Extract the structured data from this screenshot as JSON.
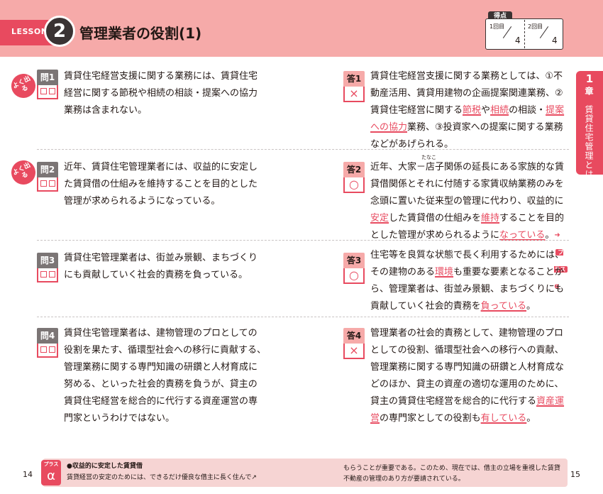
{
  "header": {
    "lesson_label": "LESSON",
    "lesson_number": "2",
    "title": "管理業者の役割(1)",
    "score": {
      "tab": "得点",
      "round1_label": "1回目",
      "round2_label": "2回目",
      "round1_total": "4",
      "round2_total": "4"
    }
  },
  "chapter": {
    "number": "1",
    "label": "章",
    "title": "賃貸住宅管理とは"
  },
  "badges": {
    "frequent": "よく出る",
    "plus": "プラス",
    "alpha": "α",
    "correct_mark": "○",
    "wrong_mark": "×"
  },
  "items": [
    {
      "q_label": "問1",
      "a_label": "答1",
      "frequent": true,
      "question": [
        "賃貸住宅経営支援に関する業務には、賃貸住宅",
        "経営に関する節税や相続の相談・提案への協力",
        "業務は含まれない。"
      ],
      "answer_mark": "×",
      "answer_parts": [
        {
          "t": "賃貸住宅経営支援に関する業務としては、①不動",
          "k": false
        },
        {
          "t": "産活用、賃貸用建物の企画提案関連業務、②賃貸",
          "k": false
        },
        {
          "t": "住宅経営に関する",
          "k": false
        },
        {
          "t": "節税",
          "k": true
        },
        {
          "t": "や",
          "k": false
        },
        {
          "t": "相続",
          "k": true
        },
        {
          "t": "の相談・",
          "k": false
        },
        {
          "t": "提案への協力",
          "k": true
        },
        {
          "t": "業務、③投資家への提案に関する業務などがあげられる。",
          "k": false
        }
      ]
    },
    {
      "q_label": "問2",
      "a_label": "答2",
      "frequent": true,
      "question": [
        "近年、賃貸住宅管理業者には、収益的に安定し",
        "た賃貸借の仕組みを維持することを目的とした",
        "管理が求められるようになっている。"
      ],
      "answer_mark": "○",
      "answer_parts": [
        {
          "t": "近年、大家－店子関係の延長にある家族的な賃貸借関係とそれに付随する家賃収納業務のみを念頭に置いた従来型の管理に代わり、収益的に",
          "k": false
        },
        {
          "t": "安定",
          "k": true
        },
        {
          "t": "した賃貸借の仕組みを",
          "k": false
        },
        {
          "t": "維持",
          "k": true
        },
        {
          "t": "することを目的とした管理が求められるように",
          "k": false
        },
        {
          "t": "なっている",
          "k": true
        },
        {
          "t": "。",
          "k": false
        }
      ],
      "ruby": "たなこ"
    },
    {
      "q_label": "問3",
      "a_label": "答3",
      "frequent": false,
      "question": [
        "賃貸住宅管理業者は、街並み景観、まちづくり",
        "にも貢献していく社会的責務を負っている。"
      ],
      "answer_mark": "○",
      "answer_parts": [
        {
          "t": "住宅等を良質な状態で長く利用するためには、その建物のある",
          "k": false
        },
        {
          "t": "環境",
          "k": true
        },
        {
          "t": "も重要な要素となることから、管理業者は、街並み景観、まちづくりにも貢献していく社会的責務を",
          "k": false
        },
        {
          "t": "負っている",
          "k": true
        },
        {
          "t": "。",
          "k": false
        }
      ]
    },
    {
      "q_label": "問4",
      "a_label": "答4",
      "frequent": false,
      "question": [
        "賃貸住宅管理業者は、建物管理のプロとしての",
        "役割を果たす、循環型社会への移行に貢献する、",
        "管理業務に関する専門知識の研鑽と人材育成に",
        "努める、といった社会的責務を負うが、貸主の",
        "賃貸住宅経営を総合的に代行する資産運営の専",
        "門家というわけではない。"
      ],
      "answer_mark": "×",
      "answer_parts": [
        {
          "t": "管理業者の社会的責務として、建物管理のプロとしての役割、循環型社会への移行への貢献、管理業務に関する専門知識の研鑽と人材育成などのほか、貸主の資産の適切な運用のために、貸主の賃貸住宅経営を総合的に代行する",
          "k": false
        },
        {
          "t": "資産運営",
          "k": true
        },
        {
          "t": "の専門家としての役割も",
          "k": false
        },
        {
          "t": "有している",
          "k": true
        },
        {
          "t": "。",
          "k": false
        }
      ]
    }
  ],
  "footer": {
    "heading": "●収益的に安定した賃貸借",
    "line1": "賃貸経営の安定のためには、できるだけ優良な借主に長く住んで↗",
    "line2": "もらうことが重要である。このため、現在では、借主の立場を重視した賃貸",
    "line3": "不動産の管理のあり方が要請されている。",
    "page_left": "14",
    "page_right": "15"
  }
}
